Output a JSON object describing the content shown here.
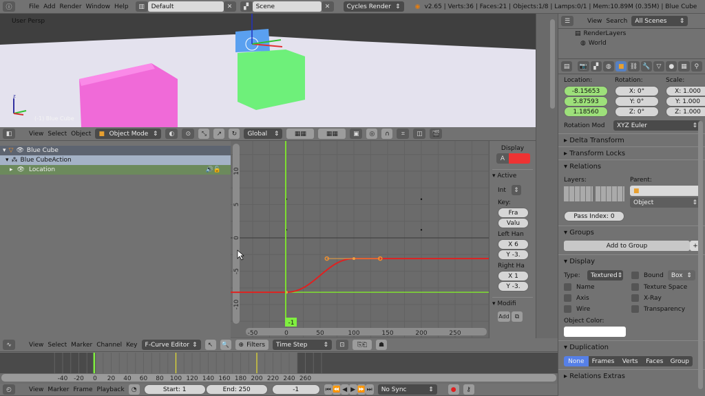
{
  "topbar": {
    "menus": [
      "File",
      "Add",
      "Render",
      "Window",
      "Help"
    ],
    "layout": "Default",
    "scene": "Scene",
    "engine": "Cycles Render",
    "stats": "v2.65 | Verts:36 | Faces:21 | Objects:1/8 | Lamps:0/1 | Mem:10.89M (0.35M) | Blue Cube"
  },
  "viewport": {
    "label": "User Persp",
    "object_label": "(-1) Blue Cube",
    "menus": [
      "View",
      "Select",
      "Object"
    ],
    "mode": "Object Mode",
    "orientation": "Global"
  },
  "channels": {
    "items": [
      {
        "label": "Blue Cube"
      },
      {
        "label": "Blue CubeAction"
      },
      {
        "label": "Location"
      }
    ]
  },
  "graph": {
    "frame_marker": "-1",
    "x_ticks": [
      "-50",
      "0",
      "50",
      "100",
      "150",
      "200",
      "250"
    ],
    "y_ticks": [
      "10",
      "5",
      "0",
      "-5",
      "-10"
    ],
    "chart_data": {
      "type": "line",
      "x": [
        0,
        100
      ],
      "y": [
        -8.16,
        -3.1
      ],
      "current_frame": -1,
      "xlim": [
        -50,
        290
      ],
      "ylim": [
        -13,
        14
      ]
    },
    "curve_color": "#e02020",
    "cursor_color": "#7fe030"
  },
  "npanel": {
    "display": "Display",
    "display_channel": "A",
    "active": "Active",
    "interp_label": "Int",
    "key": "Key:",
    "key_frame": "Fra",
    "key_value": "Valu",
    "left_handle": "Left Han",
    "left_x": "X 6",
    "left_y": "Y -3.",
    "right_handle": "Right Ha",
    "right_x": "X 1",
    "right_y": "Y -3.",
    "modifiers": "Modifi",
    "add": "Add"
  },
  "graph_header": {
    "menus": [
      "View",
      "Select",
      "Marker",
      "Channel",
      "Key"
    ],
    "editor": "F-Curve Editor",
    "filters": "Filters",
    "pivot": "Time Step"
  },
  "timeline": {
    "ticks": [
      "-40",
      "-20",
      "0",
      "20",
      "40",
      "60",
      "80",
      "100",
      "120",
      "140",
      "160",
      "180",
      "200",
      "220",
      "240",
      "260"
    ],
    "menus": [
      "View",
      "Marker",
      "Frame",
      "Playback"
    ],
    "start": "Start: 1",
    "end": "End: 250",
    "current": "-1",
    "sync": "No Sync"
  },
  "outliner": {
    "menus": [
      "View",
      "Search"
    ],
    "filter": "All Scenes",
    "items": [
      "RenderLayers",
      "World"
    ]
  },
  "properties": {
    "location_label": "Location:",
    "rotation_label": "Rotation:",
    "scale_label": "Scale:",
    "location": [
      "-8.15653",
      "5.87593",
      "1.18560"
    ],
    "rotation": [
      "X: 0°",
      "Y: 0°",
      "Z: 0°"
    ],
    "scale": [
      "X: 1.000",
      "Y: 1.000",
      "Z: 1.000"
    ],
    "rotation_mode_label": "Rotation Mod",
    "rotation_mode": "XYZ Euler",
    "delta": "Delta Transform",
    "locks": "Transform Locks",
    "relations": "Relations",
    "layers": "Layers:",
    "parent": "Parent:",
    "parent_type": "Object",
    "pass_index": "Pass Index: 0",
    "groups": "Groups",
    "add_group": "Add to Group",
    "display": "Display",
    "type_label": "Type:",
    "type": "Textured",
    "bound": "Bound",
    "bound_type": "Box",
    "checks": [
      "Name",
      "Texture Space",
      "Axis",
      "X-Ray",
      "Wire",
      "Transparency"
    ],
    "object_color": "Object Color:",
    "duplication": "Duplication",
    "dup_options": [
      "None",
      "Frames",
      "Verts",
      "Faces",
      "Group"
    ],
    "relations_extras": "Relations Extras"
  }
}
